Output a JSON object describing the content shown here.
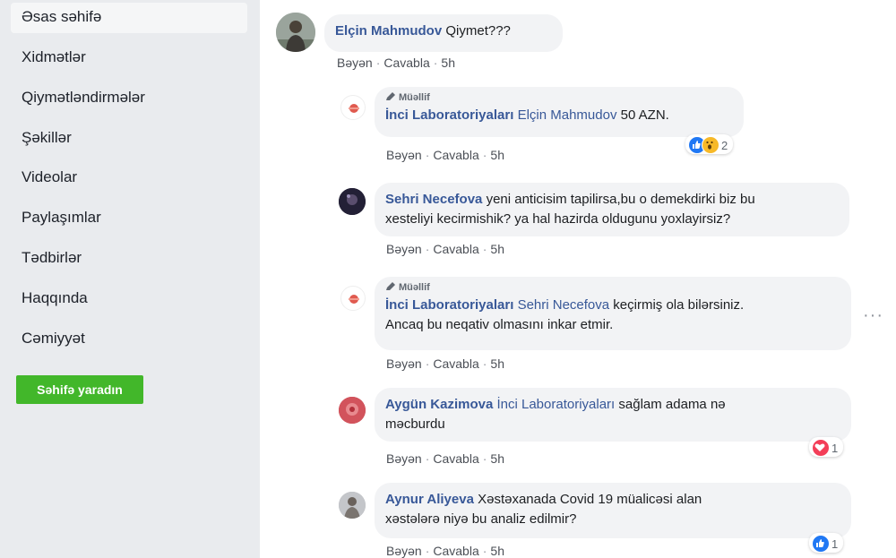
{
  "sidebar": {
    "items": [
      {
        "label": "Əsas səhifə"
      },
      {
        "label": "Xidmətlər"
      },
      {
        "label": "Qiymətləndirmələr"
      },
      {
        "label": "Şəkillər"
      },
      {
        "label": "Videolar"
      },
      {
        "label": "Paylaşımlar"
      },
      {
        "label": "Tədbirlər"
      },
      {
        "label": "Haqqında"
      },
      {
        "label": "Cəmiyyət"
      }
    ],
    "create_page_label": "Səhifə yaradın"
  },
  "comments": [
    {
      "author": "Elçin Mahmudov",
      "text": "Qiymet???",
      "actions": {
        "like": "Bəyən",
        "reply": "Cavabla",
        "time": "5h"
      }
    },
    {
      "badge": "Müəllif",
      "author": "İnci Laboratoriyaları",
      "mention": "Elçin Mahmudov",
      "text": "50 AZN.",
      "reactions": {
        "icons": [
          "like-icon",
          "wow-icon"
        ],
        "count": "2"
      },
      "actions": {
        "like": "Bəyən",
        "reply": "Cavabla",
        "time": "5h"
      }
    },
    {
      "author": "Sehri Necefova",
      "text_line1": "yeni anticisim tapilirsa,bu o demekdirki biz bu",
      "text_line2": "xesteliyi kecirmishik? ya hal hazirda oldugunu yoxlayirsiz?",
      "actions": {
        "like": "Bəyən",
        "reply": "Cavabla",
        "time": "5h"
      }
    },
    {
      "badge": "Müəllif",
      "author": "İnci Laboratoriyaları",
      "mention": "Sehri Necefova",
      "text_line1": "keçirmiş ola bilərsiniz.",
      "text_line2": "Ancaq bu neqativ olmasını inkar etmir.",
      "actions": {
        "like": "Bəyən",
        "reply": "Cavabla",
        "time": "5h"
      }
    },
    {
      "author": "Aygün Kazimova",
      "mention": "İnci Laboratoriyaları",
      "text_line1": "sağlam adama nə",
      "text_line2": "məcburdu",
      "reactions": {
        "icons": [
          "love-icon"
        ],
        "count": "1"
      },
      "actions": {
        "like": "Bəyən",
        "reply": "Cavabla",
        "time": "5h"
      }
    },
    {
      "author": "Aynur Aliyeva",
      "text_line1": "Xəstəxanada Covid 19 müalicəsi alan",
      "text_line2": "xəstələrə niyə bu analiz edilmir?",
      "reactions": {
        "icons": [
          "like-icon"
        ],
        "count": "1"
      },
      "actions": {
        "like": "Bəyən",
        "reply": "Cavabla",
        "time": "5h"
      }
    }
  ],
  "colors": {
    "link": "#385898",
    "create_button": "#42b72a",
    "like": "#2078f4",
    "love": "#f33e58",
    "wow": "#f7b928"
  }
}
